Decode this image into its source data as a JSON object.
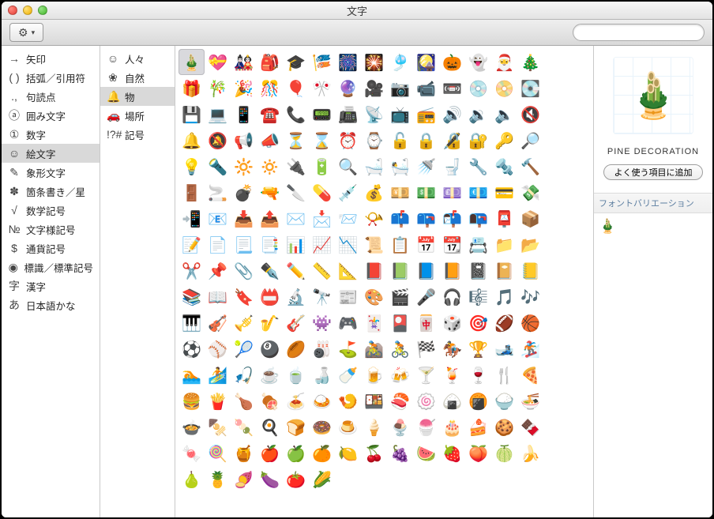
{
  "window": {
    "title": "文字"
  },
  "toolbar": {
    "gear_label": "⚙",
    "gear_arrow": "▾"
  },
  "search": {
    "placeholder": ""
  },
  "categories": [
    {
      "glyph": "→",
      "label": "矢印",
      "selected": false
    },
    {
      "glyph": "( )",
      "label": "括弧／引用符",
      "selected": false
    },
    {
      "glyph": ".,",
      "label": "句読点",
      "selected": false
    },
    {
      "glyph": "ⓐ",
      "label": "囲み文字",
      "selected": false
    },
    {
      "glyph": "①",
      "label": "数字",
      "selected": false
    },
    {
      "glyph": "☺",
      "label": "絵文字",
      "selected": true
    },
    {
      "glyph": "✎",
      "label": "象形文字",
      "selected": false
    },
    {
      "glyph": "✽",
      "label": "箇条書き／星",
      "selected": false
    },
    {
      "glyph": "√",
      "label": "数学記号",
      "selected": false
    },
    {
      "glyph": "№",
      "label": "文字様記号",
      "selected": false
    },
    {
      "glyph": "$",
      "label": "通貨記号",
      "selected": false
    },
    {
      "glyph": "◉",
      "label": "標識／標準記号",
      "selected": false
    },
    {
      "glyph": "字",
      "label": "漢字",
      "selected": false
    },
    {
      "glyph": "あ",
      "label": "日本語かな",
      "selected": false
    }
  ],
  "subcategories": [
    {
      "glyph": "☺",
      "label": "人々",
      "selected": false
    },
    {
      "glyph": "❀",
      "label": "自然",
      "selected": false
    },
    {
      "glyph": "🔔",
      "label": "物",
      "selected": true
    },
    {
      "glyph": "🚗",
      "label": "場所",
      "selected": false
    },
    {
      "glyph": "!?#",
      "label": "記号",
      "selected": false
    }
  ],
  "grid": {
    "selected_index": 0,
    "items": [
      "🎍",
      "💝",
      "🎎",
      "🎒",
      "🎓",
      "🎏",
      "🎆",
      "🎇",
      "🎐",
      "🎑",
      "🎃",
      "👻",
      "🎅",
      "🎄",
      "🎁",
      "🎋",
      "🎉",
      "🎊",
      "🎈",
      "🎌",
      "🔮",
      "🎥",
      "📷",
      "📹",
      "📼",
      "💿",
      "📀",
      "💽",
      "💾",
      "💻",
      "📱",
      "☎️",
      "📞",
      "📟",
      "📠",
      "📡",
      "📺",
      "📻",
      "🔊",
      "🔉",
      "🔈",
      "🔇",
      "🔔",
      "🔕",
      "📢",
      "📣",
      "⏳",
      "⌛",
      "⏰",
      "⌚",
      "🔓",
      "🔒",
      "🔏",
      "🔐",
      "🔑",
      "🔎",
      "💡",
      "🔦",
      "🔆",
      "🔅",
      "🔌",
      "🔋",
      "🔍",
      "🛁",
      "🛀",
      "🚿",
      "🚽",
      "🔧",
      "🔩",
      "🔨",
      "🚪",
      "🚬",
      "💣",
      "🔫",
      "🔪",
      "💊",
      "💉",
      "💰",
      "💴",
      "💵",
      "💷",
      "💶",
      "💳",
      "💸",
      "📲",
      "📧",
      "📥",
      "📤",
      "✉️",
      "📩",
      "📨",
      "📯",
      "📫",
      "📪",
      "📬",
      "📭",
      "📮",
      "📦",
      "📝",
      "📄",
      "📃",
      "📑",
      "📊",
      "📈",
      "📉",
      "📜",
      "📋",
      "📅",
      "📆",
      "📇",
      "📁",
      "📂",
      "✂️",
      "📌",
      "📎",
      "✒️",
      "✏️",
      "📏",
      "📐",
      "📕",
      "📗",
      "📘",
      "📙",
      "📓",
      "📔",
      "📒",
      "📚",
      "📖",
      "🔖",
      "📛",
      "🔬",
      "🔭",
      "📰",
      "🎨",
      "🎬",
      "🎤",
      "🎧",
      "🎼",
      "🎵",
      "🎶",
      "🎹",
      "🎻",
      "🎺",
      "🎷",
      "🎸",
      "👾",
      "🎮",
      "🃏",
      "🎴",
      "🀄",
      "🎲",
      "🎯",
      "🏈",
      "🏀",
      "⚽",
      "⚾",
      "🎾",
      "🎱",
      "🏉",
      "🎳",
      "⛳",
      "🚵",
      "🚴",
      "🏁",
      "🏇",
      "🏆",
      "🎿",
      "🏂",
      "🏊",
      "🏄",
      "🎣",
      "☕",
      "🍵",
      "🍶",
      "🍼",
      "🍺",
      "🍻",
      "🍸",
      "🍹",
      "🍷",
      "🍴",
      "🍕",
      "🍔",
      "🍟",
      "🍗",
      "🍖",
      "🍝",
      "🍛",
      "🍤",
      "🍱",
      "🍣",
      "🍥",
      "🍙",
      "🍘",
      "🍚",
      "🍜",
      "🍲",
      "🍢",
      "🍡",
      "🍳",
      "🍞",
      "🍩",
      "🍮",
      "🍦",
      "🍨",
      "🍧",
      "🎂",
      "🍰",
      "🍪",
      "🍫",
      "🍬",
      "🍭",
      "🍯",
      "🍎",
      "🍏",
      "🍊",
      "🍋",
      "🍒",
      "🍇",
      "🍉",
      "🍓",
      "🍑",
      "🍈",
      "🍌",
      "🍐",
      "🍍",
      "🍠",
      "🍆",
      "🍅",
      "🌽"
    ]
  },
  "detail": {
    "preview": "🎍",
    "name": "PINE DECORATION",
    "add_favorite_label": "よく使う項目に追加",
    "variation_heading": "フォントバリエーション",
    "variation_sample": "🎍"
  }
}
